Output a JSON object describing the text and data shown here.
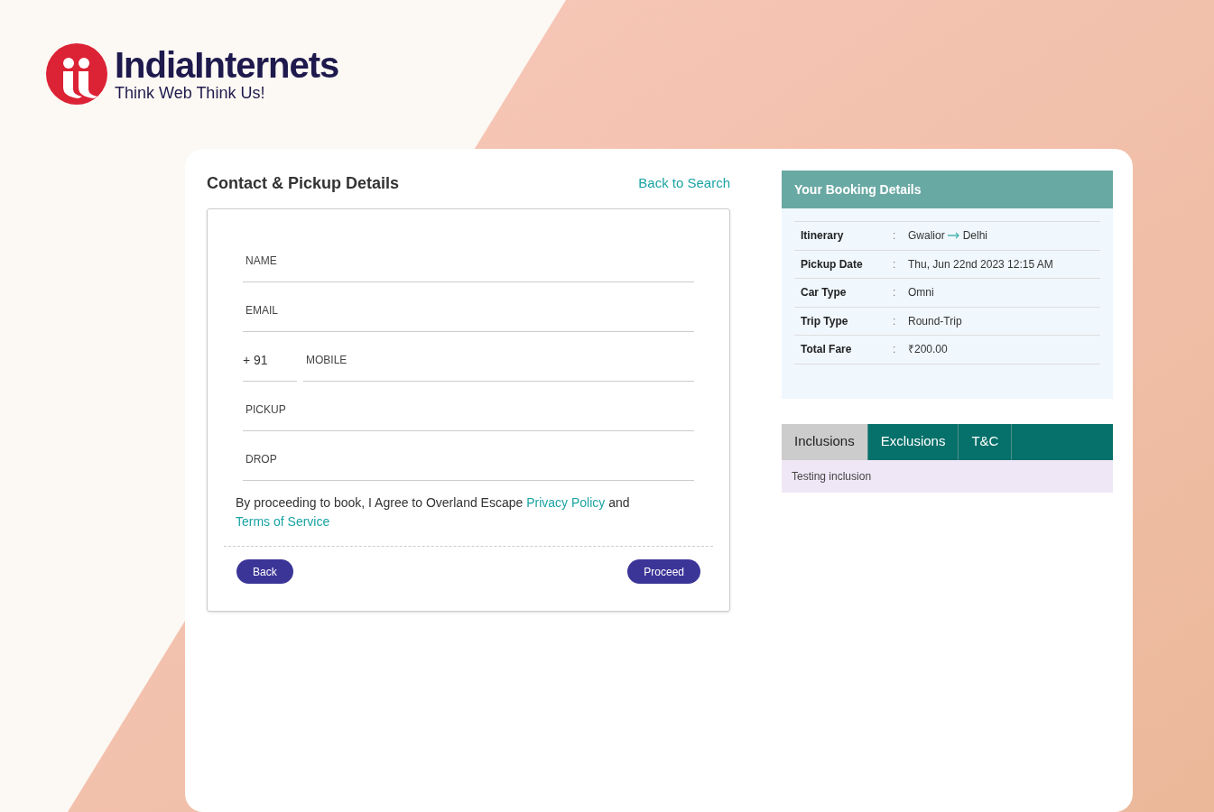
{
  "brand": {
    "name": "IndiaInternets",
    "tagline": "Think Web Think Us!"
  },
  "contact": {
    "title": "Contact & Pickup Details",
    "back_link": "Back to Search",
    "fields": [
      {
        "kind": "text",
        "placeholder": "NAME"
      },
      {
        "kind": "text",
        "placeholder": "EMAIL"
      },
      {
        "kind": "phone",
        "prefix": "+ 91",
        "placeholder": "MOBILE"
      },
      {
        "kind": "text",
        "placeholder": "PICKUP"
      },
      {
        "kind": "text",
        "placeholder": "DROP"
      }
    ],
    "agreement": {
      "text": "By proceeding to book, I Agree to Overland Escape",
      "link1": "Privacy Policy",
      "joiner": "and",
      "link2": "Terms of Service"
    },
    "buttons": {
      "back": "Back",
      "proceed": "Proceed"
    }
  },
  "booking": {
    "title": "Your Booking Details",
    "rows": [
      {
        "kind": "route",
        "label": "Itinerary",
        "from": "Gwalior",
        "to": "Delhi"
      },
      {
        "kind": "text",
        "label": "Pickup Date",
        "value": "Thu, Jun 22nd 2023 12:15 AM"
      },
      {
        "kind": "text",
        "label": "Car Type",
        "value": "Omni"
      },
      {
        "kind": "text",
        "label": "Trip Type",
        "value": "Round-Trip"
      },
      {
        "kind": "text",
        "label": "Total Fare",
        "value": "₹200.00"
      }
    ],
    "separator": ":"
  },
  "tabs": [
    {
      "label": "Inclusions",
      "selected": true
    },
    {
      "label": "Exclusions",
      "selected": false
    },
    {
      "label": "T&C",
      "selected": false
    }
  ],
  "tab_content": "Testing inclusion"
}
